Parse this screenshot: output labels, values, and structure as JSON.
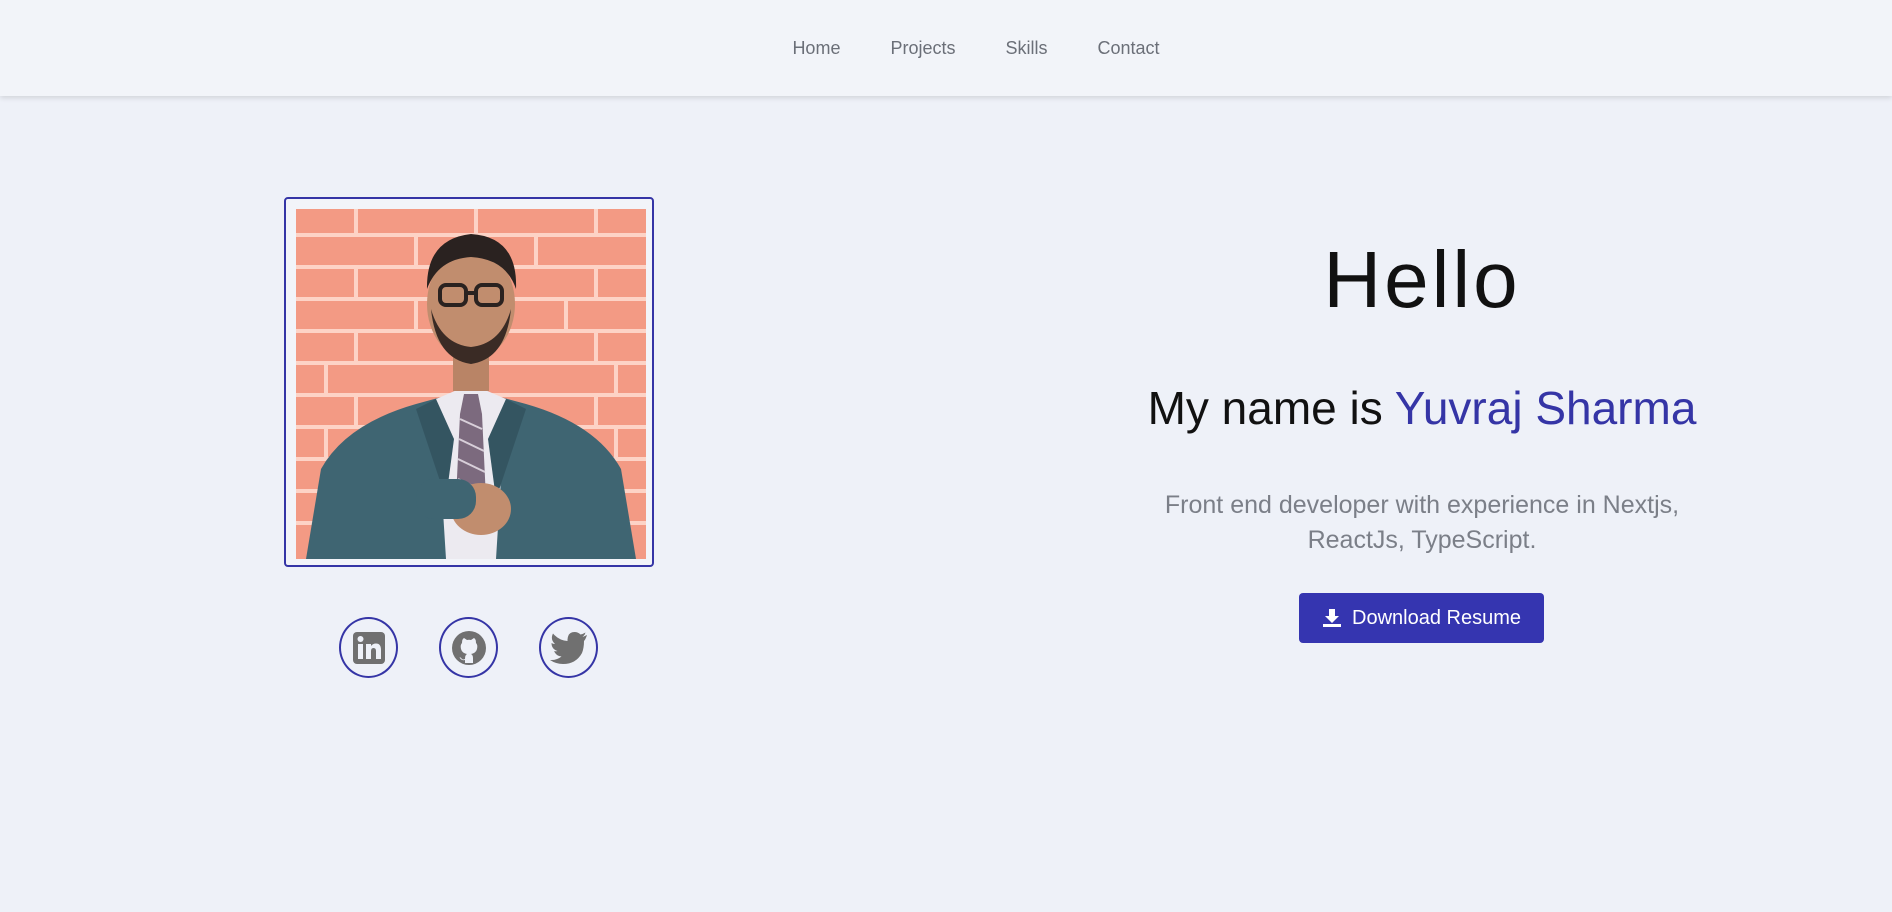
{
  "nav": {
    "items": [
      {
        "label": "Home"
      },
      {
        "label": "Projects"
      },
      {
        "label": "Skills"
      },
      {
        "label": "Contact"
      }
    ]
  },
  "profile": {
    "photo_icon": "portrait-photo",
    "socials": [
      {
        "name": "LinkedIn",
        "icon": "linkedin-icon"
      },
      {
        "name": "GitHub",
        "icon": "github-icon"
      },
      {
        "name": "Twitter",
        "icon": "twitter-icon"
      }
    ]
  },
  "hero": {
    "greeting": "Hello",
    "name_prefix": "My name is",
    "name": "Yuvraj Sharma",
    "description": "Front end developer with experience in Nextjs, ReactJs, TypeScript.",
    "resume_button": "Download Resume",
    "resume_icon": "download-icon"
  },
  "colors": {
    "accent": "#3535a6",
    "background": "#eef1f8",
    "muted_text": "#7b7f88"
  }
}
